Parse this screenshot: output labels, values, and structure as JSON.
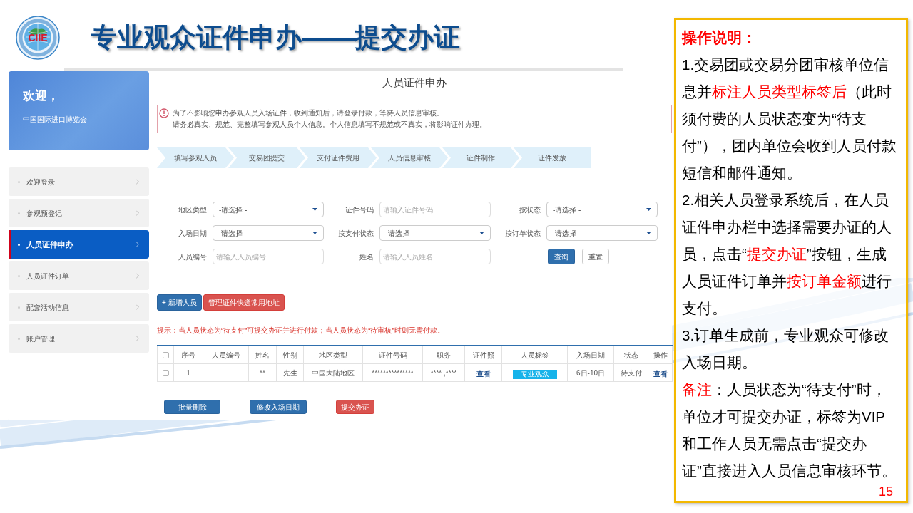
{
  "slide": {
    "title": "专业观众证件申办——提交办证",
    "logo_text": "CIIE",
    "page_number": "15"
  },
  "sidebar": {
    "welcome": {
      "greeting": "欢迎，",
      "organization": "中国国际进口博览会"
    },
    "items": [
      {
        "label": "欢迎登录",
        "selected": false
      },
      {
        "label": "参观预登记",
        "selected": false
      },
      {
        "label": "人员证件申办",
        "selected": true
      },
      {
        "label": "人员证件订单",
        "selected": false
      },
      {
        "label": "配套活动信息",
        "selected": false
      },
      {
        "label": "账户管理",
        "selected": false
      }
    ]
  },
  "main": {
    "heading": "人员证件申办",
    "notice": [
      "为了不影响您申办参观人员入场证件，收到通知后，请登录付款，等待人员信息审核。",
      "请务必真实、规范、完整填写参观人员个人信息。个人信息填写不规范或不真实，将影响证件办理。"
    ],
    "steps": [
      "填写参观人员",
      "交易团提交",
      "支付证件费用",
      "人员信息审核",
      "证件制作",
      "证件发放"
    ],
    "filters": [
      {
        "label": "地区类型",
        "kind": "select",
        "value": "-请选择 -"
      },
      {
        "label": "证件号码",
        "kind": "input",
        "placeholder": "请输入证件号码"
      },
      {
        "label": "按状态",
        "kind": "select",
        "value": "-请选择 -"
      },
      {
        "label": "入场日期",
        "kind": "select",
        "value": "-请选择 -"
      },
      {
        "label": "按支付状态",
        "kind": "select",
        "value": "-请选择 -"
      },
      {
        "label": "按订单状态",
        "kind": "select",
        "value": "-请选择 -"
      },
      {
        "label": "人员编号",
        "kind": "input",
        "placeholder": "请输入人员编号"
      },
      {
        "label": "姓名",
        "kind": "input",
        "placeholder": "请输入人员姓名"
      }
    ],
    "filter_buttons": [
      {
        "label": "查询",
        "kind": "primary"
      },
      {
        "label": "重置",
        "kind": "default"
      }
    ],
    "toolbar_buttons": [
      {
        "label": "+ 新增人员",
        "kind": "primary"
      },
      {
        "label": "管理证件快递常用地址",
        "kind": "danger"
      }
    ],
    "hint": "提示：当人员状态为“待支付”可提交办证并进行付款；当人员状态为“待审核”时则无需付款。",
    "table": {
      "select_all_checked": false,
      "columns": [
        "序号",
        "人员编号",
        "姓名",
        "性别",
        "地区类型",
        "证件号码",
        "职务",
        "证件照",
        "人员标签",
        "入场日期",
        "状态",
        "操作"
      ],
      "rows": [
        {
          "checked": false,
          "cells": [
            {
              "kind": "text",
              "text": "1"
            },
            {
              "kind": "empty"
            },
            {
              "kind": "text",
              "text": "**"
            },
            {
              "kind": "text",
              "text": "先生"
            },
            {
              "kind": "text",
              "text": "中国大陆地区"
            },
            {
              "kind": "text",
              "text": "***************"
            },
            {
              "kind": "text",
              "text": "**** ,****"
            },
            {
              "kind": "link",
              "text": "查看"
            },
            {
              "kind": "tag",
              "text": "专业观众"
            },
            {
              "kind": "text",
              "text": "6日-10日"
            },
            {
              "kind": "text",
              "text": "待支付"
            },
            {
              "kind": "link",
              "text": "查看"
            }
          ]
        }
      ]
    },
    "action_buttons": [
      {
        "label": "批量删除",
        "kind": "primary"
      },
      {
        "label": "修改入场日期",
        "kind": "primary"
      },
      {
        "label": "提交办证",
        "kind": "danger"
      }
    ]
  },
  "instructions": {
    "heading": "操作说明：",
    "paragraphs": [
      [
        {
          "text": "1.交易团或交易分团审核单位信息并",
          "highlighted": false
        },
        {
          "text": "标注人员类型标签后",
          "highlighted": true
        },
        {
          "text": "（此时须付费的人员状态变为“待支付”），团内单位会收到人员付款短信和邮件通知。",
          "highlighted": false
        }
      ],
      [
        {
          "text": "2.相关人员登录系统后，在人员证件申办栏中选择需要办证的人员，点击“",
          "highlighted": false
        },
        {
          "text": "提交办证",
          "highlighted": true
        },
        {
          "text": "”按钮，生成人员证件订单并",
          "highlighted": false
        },
        {
          "text": "按订单金额",
          "highlighted": true
        },
        {
          "text": "进行支付。",
          "highlighted": false
        }
      ],
      [
        {
          "text": "3.订单生成前，专业观众可修改入场日期。",
          "highlighted": false
        }
      ],
      [
        {
          "text": "备注",
          "highlighted": true
        },
        {
          "text": "：人员状态为“待支付”时，单位才可提交办证，标签为VIP和工作人员无需点击“提交办证”直接进入人员信息审核环节。",
          "highlighted": false
        }
      ]
    ]
  }
}
